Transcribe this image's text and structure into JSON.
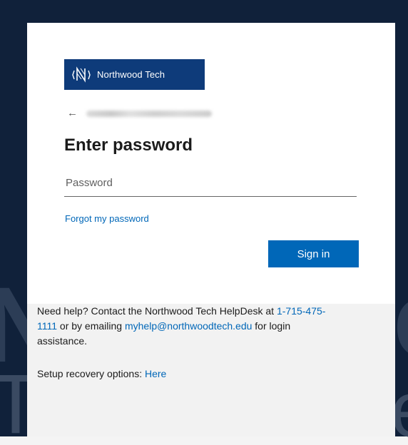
{
  "background": {
    "color": "#10213a",
    "watermark_letters": [
      "N",
      "T",
      "C",
      "e"
    ]
  },
  "logo": {
    "text": "Northwood Tech",
    "color": "#0e3b7a",
    "icon": "northwood-logo-icon"
  },
  "back": {
    "icon": "back-arrow-icon",
    "glyph": "←"
  },
  "form": {
    "title": "Enter password",
    "password_placeholder": "Password",
    "password_value": "",
    "forgot_label": "Forgot my password",
    "signin_label": "Sign in",
    "accent": "#0067b8"
  },
  "help": {
    "line_prefix": "Need help? Contact the Northwood Tech HelpDesk at ",
    "phone": "1-715-475-1111",
    "line_mid": " or by emailing ",
    "email": "myhelp@northwoodtech.edu",
    "line_suffix": " for login assistance.",
    "recovery_prefix": "Setup recovery options: ",
    "recovery_link": "Here"
  }
}
